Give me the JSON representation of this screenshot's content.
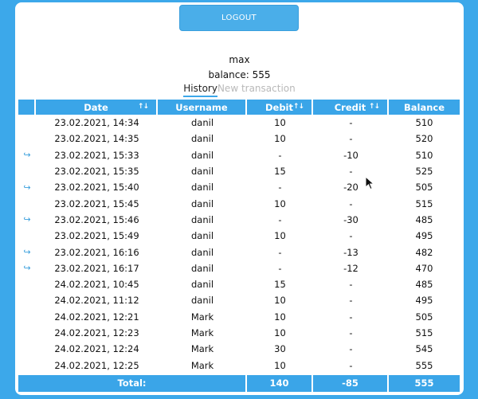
{
  "header": {
    "logout_label": "LOGOUT"
  },
  "user": {
    "name": "max",
    "balance_text": "balance: 555"
  },
  "tabs": [
    {
      "label": "History",
      "active": true
    },
    {
      "label": "New transaction",
      "active": false
    }
  ],
  "table": {
    "columns": [
      "",
      "Date",
      "Username",
      "Debit",
      "Credit",
      "Balance"
    ],
    "sort_icon": "↑↓",
    "rows": [
      {
        "icon": "",
        "date": "23.02.2021, 14:34",
        "user": "danil",
        "debit": "10",
        "credit": "-",
        "balance": "510"
      },
      {
        "icon": "",
        "date": "23.02.2021, 14:35",
        "user": "danil",
        "debit": "10",
        "credit": "-",
        "balance": "520"
      },
      {
        "icon": "↪",
        "date": "23.02.2021, 15:33",
        "user": "danil",
        "debit": "-",
        "credit": "-10",
        "balance": "510"
      },
      {
        "icon": "",
        "date": "23.02.2021, 15:35",
        "user": "danil",
        "debit": "15",
        "credit": "-",
        "balance": "525"
      },
      {
        "icon": "↪",
        "date": "23.02.2021, 15:40",
        "user": "danil",
        "debit": "-",
        "credit": "-20",
        "balance": "505"
      },
      {
        "icon": "",
        "date": "23.02.2021, 15:45",
        "user": "danil",
        "debit": "10",
        "credit": "-",
        "balance": "515"
      },
      {
        "icon": "↪",
        "date": "23.02.2021, 15:46",
        "user": "danil",
        "debit": "-",
        "credit": "-30",
        "balance": "485"
      },
      {
        "icon": "",
        "date": "23.02.2021, 15:49",
        "user": "danil",
        "debit": "10",
        "credit": "-",
        "balance": "495"
      },
      {
        "icon": "↪",
        "date": "23.02.2021, 16:16",
        "user": "danil",
        "debit": "-",
        "credit": "-13",
        "balance": "482"
      },
      {
        "icon": "↪",
        "date": "23.02.2021, 16:17",
        "user": "danil",
        "debit": "-",
        "credit": "-12",
        "balance": "470"
      },
      {
        "icon": "",
        "date": "24.02.2021, 10:45",
        "user": "danil",
        "debit": "15",
        "credit": "-",
        "balance": "485"
      },
      {
        "icon": "",
        "date": "24.02.2021, 11:12",
        "user": "danil",
        "debit": "10",
        "credit": "-",
        "balance": "495"
      },
      {
        "icon": "",
        "date": "24.02.2021, 12:21",
        "user": "Mark",
        "debit": "10",
        "credit": "-",
        "balance": "505"
      },
      {
        "icon": "",
        "date": "24.02.2021, 12:23",
        "user": "Mark",
        "debit": "10",
        "credit": "-",
        "balance": "515"
      },
      {
        "icon": "",
        "date": "24.02.2021, 12:24",
        "user": "Mark",
        "debit": "30",
        "credit": "-",
        "balance": "545"
      },
      {
        "icon": "",
        "date": "24.02.2021, 12:25",
        "user": "Mark",
        "debit": "10",
        "credit": "-",
        "balance": "555"
      }
    ],
    "footer": {
      "label": "Total:",
      "debit": "140",
      "credit": "-85",
      "balance": "555"
    }
  },
  "colors": {
    "accent": "#3aa5e8",
    "background": "#3ca8ea"
  },
  "icons": {
    "reply": "reply-arrow-icon",
    "sort": "sort-arrows-icon",
    "cursor": "mouse-cursor-icon"
  }
}
